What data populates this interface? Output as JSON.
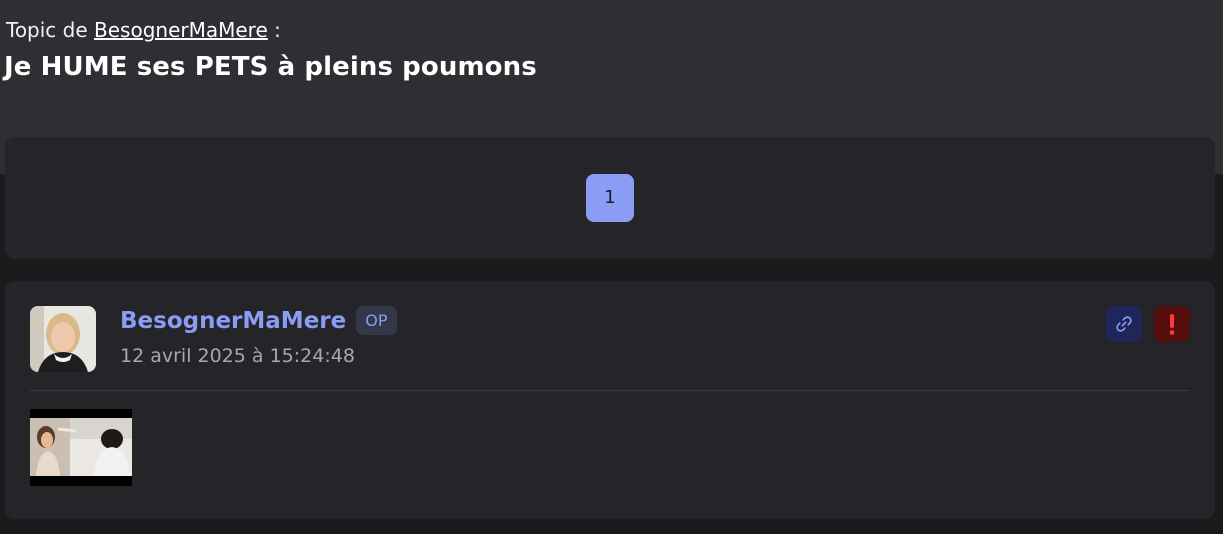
{
  "topic": {
    "prefix": "Topic de",
    "author_link": "BesognerMaMere",
    "suffix": ":",
    "title": "Je HUME ses PETS à pleins poumons"
  },
  "pagination": {
    "current_page": "1"
  },
  "post": {
    "author": "BesognerMaMere",
    "badge": "OP",
    "date": "12 avril 2025 à 15:24:48"
  },
  "colors": {
    "accent": "#8a9cf3",
    "background": "#1b1b1d",
    "card": "#252529",
    "link_button": "#1f2659",
    "report_button": "#550d0d",
    "report_icon": "#ff3b3b"
  },
  "icons": {
    "link": "link-icon",
    "report": "exclamation-icon"
  }
}
